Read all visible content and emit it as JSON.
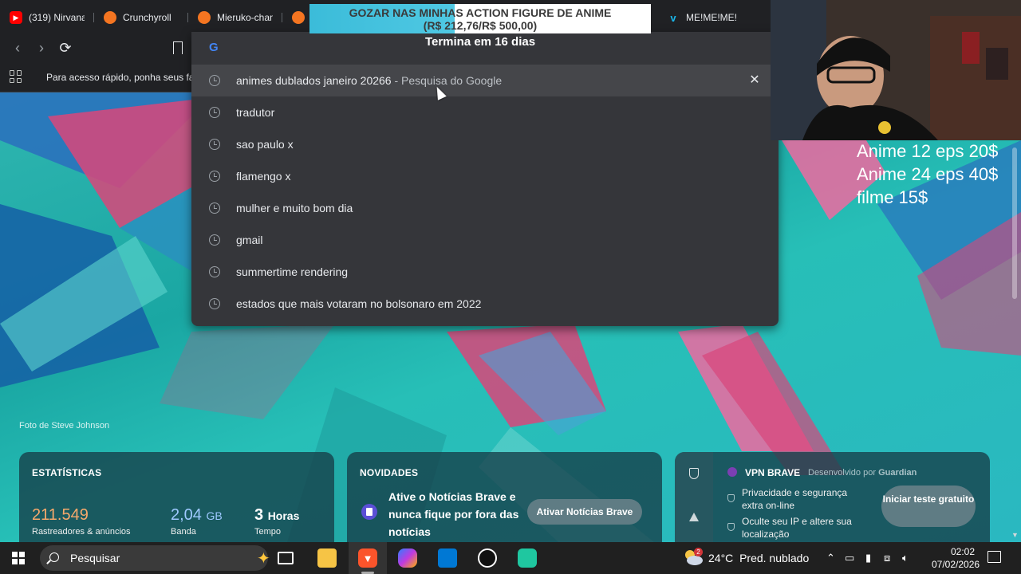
{
  "tabs": [
    {
      "label": "(319) Nirvana",
      "icon": "youtube-icon",
      "color": "#ff0000"
    },
    {
      "label": "Crunchyroll",
      "icon": "crunchyroll-icon",
      "color": "#f47521"
    },
    {
      "label": "Mieruko-chan",
      "icon": "crunchyroll-icon",
      "color": "#f47521"
    },
    {
      "label": "",
      "icon": "crunchyroll-icon",
      "color": "#f47521"
    },
    {
      "label": "ME!ME!ME!",
      "icon": "vimeo-icon",
      "color": "#1ab7ea"
    }
  ],
  "bookmarks": {
    "hint": "Para acesso rápido, ponha seus fav"
  },
  "omnibox": {
    "suggestions": [
      {
        "text": "animes dublados janeiro 20266",
        "sub": " - Pesquisa do Google",
        "highlighted": true
      },
      {
        "text": "tradutor",
        "sub": ""
      },
      {
        "text": "sao paulo x",
        "sub": ""
      },
      {
        "text": "flamengo x",
        "sub": ""
      },
      {
        "text": "mulher e muito bom dia",
        "sub": ""
      },
      {
        "text": "gmail",
        "sub": ""
      },
      {
        "text": "summertime rendering",
        "sub": ""
      },
      {
        "text": "estados que mais votaram no bolsonaro em 2022",
        "sub": ""
      }
    ],
    "remove_symbol": "✕"
  },
  "overlay": {
    "banner_title": "GOZAR NAS MINHAS ACTION FIGURE DE ANIME",
    "banner_sub": "(R$ 212,76/R$ 500,00)",
    "banner_progress": 0.4255,
    "banner_footer": "Termina em 16 dias",
    "prices": [
      "Anime 12 eps 20$",
      "Anime 24 eps 40$",
      "filme 15$"
    ]
  },
  "page": {
    "credit": "Foto de Steve Johnson",
    "stats": {
      "title": "ESTATÍSTICAS",
      "trackers_value": "211.549",
      "trackers_label": "Rastreadores & anúncios",
      "bandwidth_value": "2,04",
      "bandwidth_unit": "GB",
      "bandwidth_label": "Banda",
      "time_value": "3",
      "time_unit": "Horas",
      "time_label": "Tempo",
      "trackers_color": "#f6a96c",
      "bandwidth_color": "#9ec9ff"
    },
    "news": {
      "title": "NOVIDADES",
      "text": "Ative o Notícias Brave e nunca fique por fora das notícias",
      "button": "Ativar Notícias Brave"
    },
    "vpn": {
      "title": "VPN BRAVE",
      "by": "Desenvolvido por",
      "by_brand": "Guardian",
      "item1": "Privacidade e segurança extra on-line",
      "item2": "Oculte seu IP e altere sua localização",
      "button": "Iniciar teste gratuito"
    }
  },
  "taskbar": {
    "search": "Pesquisar",
    "weather_badge": "2",
    "temp": "24°C",
    "forecast": "Pred. nublado",
    "time": "02:02",
    "date": "07/02/2026"
  }
}
